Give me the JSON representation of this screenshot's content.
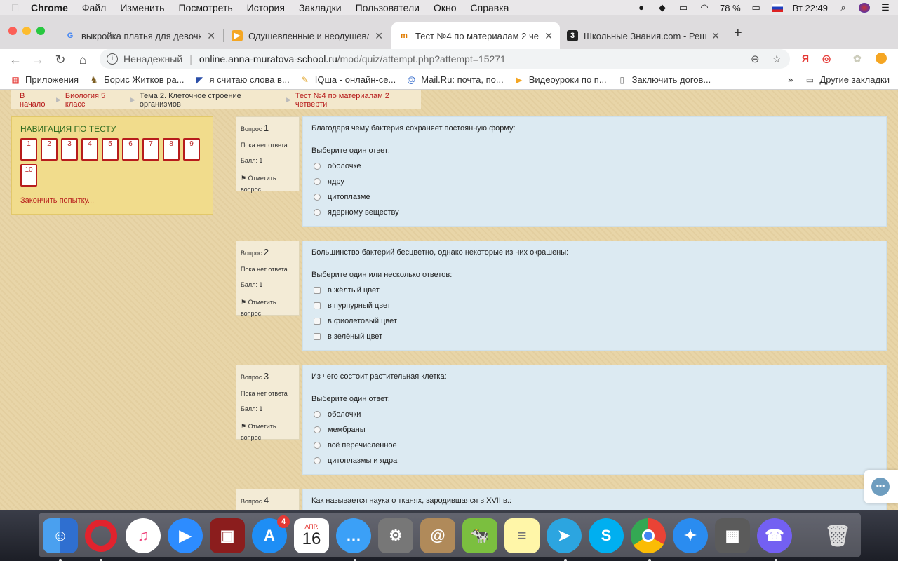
{
  "menubar": {
    "items": [
      "Chrome",
      "Файл",
      "Изменить",
      "Посмотреть",
      "История",
      "Закладки",
      "Пользователи",
      "Окно",
      "Справка"
    ],
    "battery": "78 %",
    "clock": "Вт 22:49"
  },
  "tabs": [
    {
      "title": "выкройка платья для девочке",
      "active": false
    },
    {
      "title": "Одушевленные и неодушевле",
      "active": false
    },
    {
      "title": "Тест №4 по материалам 2 че",
      "active": true
    },
    {
      "title": "Школьные Знания.com - Реш",
      "active": false
    }
  ],
  "omnibox": {
    "insecure_label": "Ненадежный",
    "host": "online.anna-muratova-school.ru",
    "path": "/mod/quiz/attempt.php?attempt=15271"
  },
  "extensions": {
    "yandex": "Я"
  },
  "bookmarks": [
    "Приложения",
    "Борис Житков ра...",
    "я считаю слова в...",
    "IQша - онлайн-се...",
    "Mail.Ru: почта, по...",
    "Видеоуроки по п...",
    "Заключить догов..."
  ],
  "bookmarks_other": "Другие закладки",
  "breadcrumb": [
    {
      "label": "В начало"
    },
    {
      "label": "Биология 5 класс"
    },
    {
      "label": "Тема 2. Клеточное строение организмов"
    },
    {
      "label": "Тест №4 по материалам 2 четверти"
    }
  ],
  "quiz_nav": {
    "title": "НАВИГАЦИЯ ПО ТЕСТУ",
    "buttons": [
      "1",
      "2",
      "3",
      "4",
      "5",
      "6",
      "7",
      "8",
      "9",
      "10"
    ],
    "finish": "Закончить попытку..."
  },
  "question_labels": {
    "prefix": "Вопрос",
    "status": "Пока нет ответа",
    "grade": "Балл: 1",
    "flag": "Отметить вопрос"
  },
  "questions": [
    {
      "number": "1",
      "text": "Благодаря чему бактерия сохраняет постоянную форму:",
      "prompt": "Выберите один ответ:",
      "kind": "radio",
      "answers": [
        "оболочке",
        "ядру",
        "цитоплазме",
        "ядерному веществу"
      ]
    },
    {
      "number": "2",
      "text": "Большинство бактерий бесцветно, однако некоторые из них окрашены:",
      "prompt": "Выберите один или несколько ответов:",
      "kind": "checkbox",
      "answers": [
        "в жёлтый цвет",
        "в пурпурный цвет",
        "в фиолетовый цвет",
        "в зелёный цвет"
      ]
    },
    {
      "number": "3",
      "text": "Из чего состоит растительная клетка:",
      "prompt": "Выберите один ответ:",
      "kind": "radio",
      "answers": [
        "оболочки",
        "мембраны",
        "всё перечисленное",
        "цитоплазмы и ядра"
      ]
    },
    {
      "number": "4",
      "text": "Как называется наука о тканях, зародившаяся в XVII в.:"
    }
  ],
  "dock": {
    "calendar_month": "АПР.",
    "calendar_day": "16",
    "appstore_badge": "4"
  }
}
